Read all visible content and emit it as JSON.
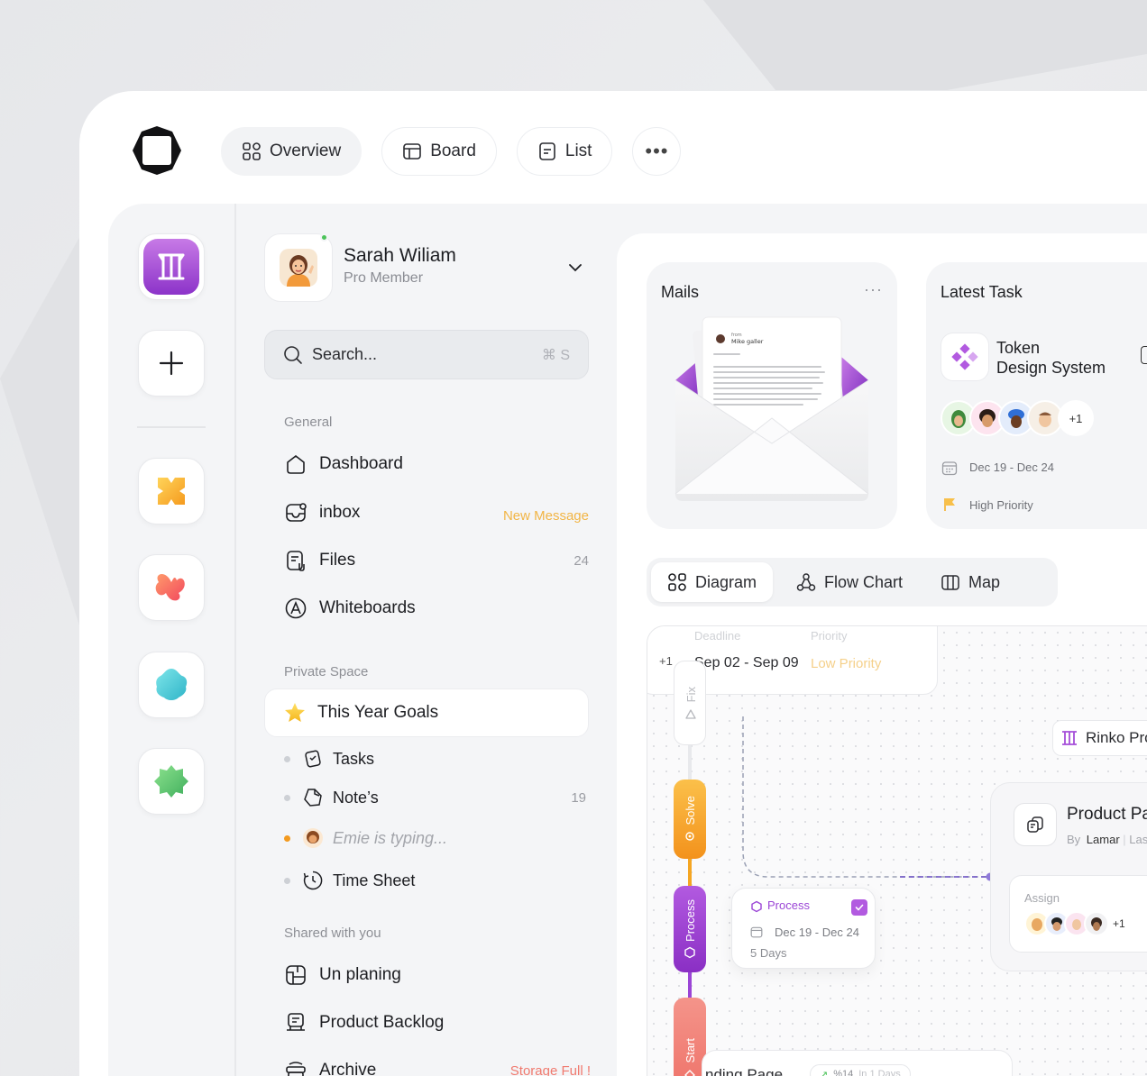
{
  "topnav": {
    "tabs": [
      {
        "label": "Overview",
        "icon": "grid-icon",
        "active": true
      },
      {
        "label": "Board",
        "icon": "board-icon",
        "active": false
      },
      {
        "label": "List",
        "icon": "list-icon",
        "active": false
      }
    ],
    "more_label": "•••"
  },
  "profile": {
    "name": "Sarah Wiliam",
    "role": "Pro Member",
    "online": true
  },
  "search": {
    "placeholder": "Search...",
    "shortcut": "⌘ S"
  },
  "sidebar": {
    "general_label": "General",
    "general_items": [
      {
        "label": "Dashboard",
        "icon": "home-icon",
        "meta": ""
      },
      {
        "label": "inbox",
        "icon": "inbox-icon",
        "meta": "New Message"
      },
      {
        "label": "Files",
        "icon": "files-icon",
        "meta": "24"
      },
      {
        "label": "Whiteboards",
        "icon": "whiteboard-icon",
        "meta": ""
      }
    ],
    "private_label": "Private Space",
    "goal": {
      "label": "This Year Goals",
      "icon": "star-icon"
    },
    "private_items": [
      {
        "label": "Tasks",
        "icon": "tasks-icon",
        "meta": ""
      },
      {
        "label": "Note’s",
        "icon": "notes-icon",
        "meta": "19"
      },
      {
        "label": "Emie is typing...",
        "icon": "avatar-icon",
        "meta": ""
      },
      {
        "label": "Time Sheet",
        "icon": "clock-icon",
        "meta": ""
      }
    ],
    "shared_label": "Shared with you",
    "shared_items": [
      {
        "label": "Un planing",
        "icon": "layout-icon",
        "meta": ""
      },
      {
        "label": "Product Backlog",
        "icon": "backlog-icon",
        "meta": ""
      },
      {
        "label": "Archive",
        "icon": "archive-icon",
        "meta": "Storage Full !"
      }
    ]
  },
  "mails": {
    "title": "Mails",
    "more": "···",
    "letter_from_label": "from",
    "letter_sender": "Mike galler"
  },
  "latest_task": {
    "title": "Latest Task",
    "task_name_1": "Token",
    "task_name_2": "Design System",
    "extra_members": "+1",
    "date_range": "Dec 19 - Dec 24",
    "priority": "High Priority"
  },
  "view_tabs": [
    {
      "label": "Diagram",
      "icon": "diagram-icon",
      "active": true
    },
    {
      "label": "Flow Chart",
      "icon": "flowchart-icon",
      "active": false
    },
    {
      "label": "Map",
      "icon": "map-icon",
      "active": false
    }
  ],
  "canvas": {
    "top_card": {
      "extra": "+1",
      "deadline_label": "Deadline",
      "deadline": "Sep 02 - Sep 09",
      "priority_label": "Priority",
      "priority": "Low Priority"
    },
    "stages": [
      {
        "label": "Fix",
        "color": "#ffffff"
      },
      {
        "label": "Solve",
        "color": "#f5a623"
      },
      {
        "label": "Process",
        "color": "#9b45d6"
      },
      {
        "label": "Start",
        "color": "#f07d72"
      }
    ],
    "process_card": {
      "label": "Process",
      "date": "Dec 19 - Dec 24",
      "duration": "5 Days"
    },
    "rinko_label": "Rinko Pro",
    "product_card": {
      "title": "Product Pa",
      "by_label": "By",
      "author": "Lamar",
      "suffix": "Las",
      "assign_label": "Assign",
      "extra_members": "+1"
    },
    "bottom_card": {
      "title": "nding Page",
      "stat": "%14",
      "sub": "In 1 Days"
    }
  }
}
